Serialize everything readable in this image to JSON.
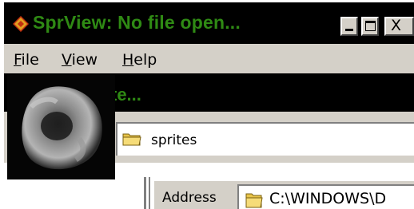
{
  "window": {
    "title": "SprView: No file open...",
    "app_icon": "diamond-app-icon",
    "controls": {
      "minimize_icon": "minimize-icon",
      "maximize_icon": "maximize-icon",
      "close_label": "X"
    }
  },
  "menubar": {
    "items": [
      {
        "accel": "F",
        "rest": "ile"
      },
      {
        "accel": "V",
        "rest": "iew"
      },
      {
        "accel": "H",
        "rest": "elp"
      }
    ]
  },
  "secondary_title": {
    "text": "te..."
  },
  "folder_bar": {
    "icon": "folder-icon",
    "label": "sprites"
  },
  "address_bar": {
    "label": "Address",
    "icon": "folder-icon",
    "value": "C:\\WINDOWS\\D"
  },
  "sprite_preview": {
    "icon": "sprite-thumbnail"
  },
  "colors": {
    "title_text": "#2f8a14",
    "titlebar_bg": "#000000",
    "chrome": "#d4d0c8"
  }
}
